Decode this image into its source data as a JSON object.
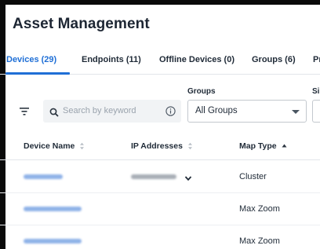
{
  "page": {
    "title": "Asset Management"
  },
  "tabs": [
    {
      "label": "Devices (29)",
      "active": true
    },
    {
      "label": "Endpoints (11)",
      "active": false
    },
    {
      "label": "Offline Devices (0)",
      "active": false
    },
    {
      "label": "Groups (6)",
      "active": false
    },
    {
      "label": "Pr",
      "active": false
    }
  ],
  "filters": {
    "search_placeholder": "Search by keyword",
    "groups_label": "Groups",
    "groups_value": "All Groups",
    "site_label": "Si"
  },
  "table": {
    "columns": [
      {
        "label": "Device Name",
        "sort": "none"
      },
      {
        "label": "IP Addresses",
        "sort": "none"
      },
      {
        "label": "Map Type",
        "sort": "asc"
      }
    ],
    "rows": [
      {
        "device_name": "(redacted)",
        "ip_address": "(redacted)",
        "expandable": true,
        "map_type": "Cluster"
      },
      {
        "device_name": "(redacted)",
        "ip_address": "",
        "expandable": false,
        "map_type": "Max Zoom"
      },
      {
        "device_name": "(redacted)",
        "ip_address": "",
        "expandable": false,
        "map_type": "Max Zoom"
      }
    ]
  },
  "colors": {
    "accent": "#1f6fd6",
    "text": "#1f2a37",
    "muted": "#9aa3ad",
    "link_redacted": "#8fb2e8"
  },
  "icons": {
    "filter": "filter-lines-icon",
    "search": "magnifier-icon",
    "info": "info-circle-icon",
    "caret": "triangle-down-icon",
    "sort": "sort-arrows-icon",
    "expand": "chevron-down-icon"
  }
}
